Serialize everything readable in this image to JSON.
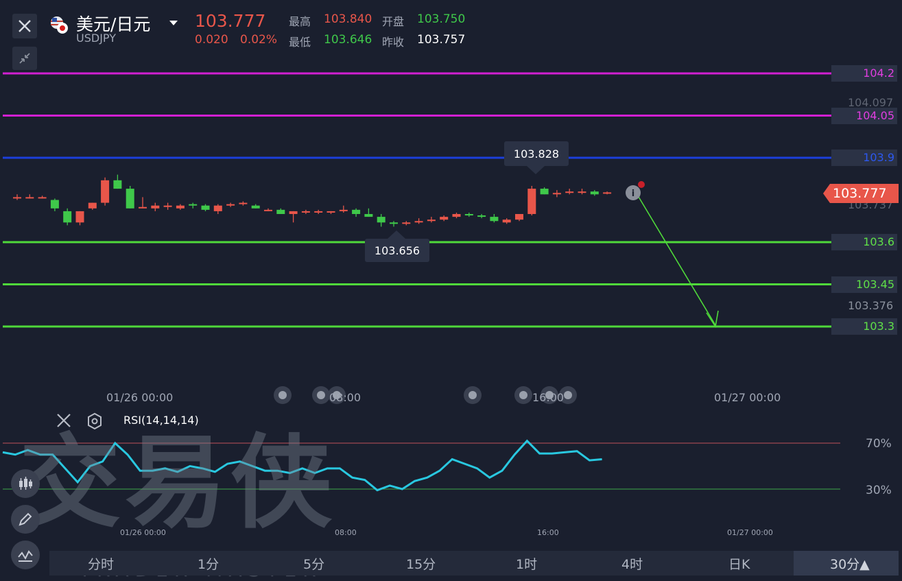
{
  "header": {
    "pair_name": "美元/日元",
    "symbol": "USDJPY",
    "price": "103.777",
    "change": "0.020",
    "change_pct": "0.02%",
    "high_label": "最高",
    "high_value": "103.840",
    "low_label": "最低",
    "low_value": "103.646",
    "open_label": "开盘",
    "open_value": "103.750",
    "prev_close_label": "昨收",
    "prev_close_value": "103.757"
  },
  "price_axis": {
    "current_price": "103.777",
    "faint_top": "104.097",
    "faint_mid": "103.737",
    "faint_bottom": "103.376"
  },
  "levels": [
    {
      "value": "104.2",
      "color": "#d21fd2"
    },
    {
      "value": "104.05",
      "color": "#d21fd2"
    },
    {
      "value": "103.9",
      "color": "#1c3fdc"
    },
    {
      "value": "103.6",
      "color": "#4fd93a"
    },
    {
      "value": "103.45",
      "color": "#4fd93a"
    },
    {
      "value": "103.3",
      "color": "#4fd93a"
    }
  ],
  "callouts": {
    "high_point": "103.828",
    "low_point": "103.656"
  },
  "time_axis": [
    "01/26 00:00",
    "08:00",
    "16:00",
    "01/27 00:00"
  ],
  "rsi": {
    "label": "RSI(14,14,14)",
    "upper": "70%",
    "lower": "30%"
  },
  "watermark": {
    "cn": "交易侠",
    "en": "TRADER MASTER"
  },
  "tabs": [
    "分时",
    "1分",
    "5分",
    "15分",
    "1时",
    "4时",
    "日K",
    "30分▲"
  ],
  "colors": {
    "up": "#e8564a",
    "down": "#3fc84a",
    "rsi_line": "#29c8e0",
    "background": "#1a1f2e"
  },
  "chart_data": {
    "type": "candlestick",
    "candles": [
      {
        "o": 103.76,
        "h": 103.77,
        "l": 103.75,
        "c": 103.76
      },
      {
        "o": 103.76,
        "h": 103.77,
        "l": 103.755,
        "c": 103.76
      },
      {
        "o": 103.76,
        "h": 103.765,
        "l": 103.755,
        "c": 103.76
      },
      {
        "o": 103.75,
        "h": 103.755,
        "l": 103.71,
        "c": 103.72
      },
      {
        "o": 103.71,
        "h": 103.72,
        "l": 103.66,
        "c": 103.67
      },
      {
        "o": 103.67,
        "h": 103.71,
        "l": 103.66,
        "c": 103.71
      },
      {
        "o": 103.72,
        "h": 103.74,
        "l": 103.715,
        "c": 103.74
      },
      {
        "o": 103.74,
        "h": 103.83,
        "l": 103.73,
        "c": 103.82
      },
      {
        "o": 103.82,
        "h": 103.84,
        "l": 103.79,
        "c": 103.79
      },
      {
        "o": 103.79,
        "h": 103.8,
        "l": 103.72,
        "c": 103.72
      },
      {
        "o": 103.72,
        "h": 103.76,
        "l": 103.72,
        "c": 103.725
      },
      {
        "o": 103.72,
        "h": 103.74,
        "l": 103.71,
        "c": 103.73
      },
      {
        "o": 103.725,
        "h": 103.74,
        "l": 103.715,
        "c": 103.73
      },
      {
        "o": 103.72,
        "h": 103.735,
        "l": 103.715,
        "c": 103.73
      },
      {
        "o": 103.735,
        "h": 103.74,
        "l": 103.72,
        "c": 103.73
      },
      {
        "o": 103.73,
        "h": 103.735,
        "l": 103.71,
        "c": 103.715
      },
      {
        "o": 103.71,
        "h": 103.735,
        "l": 103.7,
        "c": 103.73
      },
      {
        "o": 103.73,
        "h": 103.74,
        "l": 103.725,
        "c": 103.735
      },
      {
        "o": 103.735,
        "h": 103.745,
        "l": 103.73,
        "c": 103.74
      },
      {
        "o": 103.73,
        "h": 103.735,
        "l": 103.72,
        "c": 103.72
      },
      {
        "o": 103.715,
        "h": 103.72,
        "l": 103.71,
        "c": 103.715
      },
      {
        "o": 103.715,
        "h": 103.72,
        "l": 103.7,
        "c": 103.7
      },
      {
        "o": 103.7,
        "h": 103.71,
        "l": 103.67,
        "c": 103.71
      },
      {
        "o": 103.705,
        "h": 103.715,
        "l": 103.7,
        "c": 103.71
      },
      {
        "o": 103.705,
        "h": 103.715,
        "l": 103.7,
        "c": 103.71
      },
      {
        "o": 103.705,
        "h": 103.71,
        "l": 103.7,
        "c": 103.71
      },
      {
        "o": 103.71,
        "h": 103.73,
        "l": 103.705,
        "c": 103.715
      },
      {
        "o": 103.715,
        "h": 103.72,
        "l": 103.69,
        "c": 103.7
      },
      {
        "o": 103.7,
        "h": 103.72,
        "l": 103.69,
        "c": 103.69
      },
      {
        "o": 103.69,
        "h": 103.7,
        "l": 103.655,
        "c": 103.67
      },
      {
        "o": 103.67,
        "h": 103.675,
        "l": 103.655,
        "c": 103.665
      },
      {
        "o": 103.665,
        "h": 103.675,
        "l": 103.66,
        "c": 103.67
      },
      {
        "o": 103.67,
        "h": 103.685,
        "l": 103.665,
        "c": 103.675
      },
      {
        "o": 103.675,
        "h": 103.69,
        "l": 103.67,
        "c": 103.68
      },
      {
        "o": 103.68,
        "h": 103.695,
        "l": 103.675,
        "c": 103.69
      },
      {
        "o": 103.69,
        "h": 103.705,
        "l": 103.685,
        "c": 103.7
      },
      {
        "o": 103.7,
        "h": 103.705,
        "l": 103.69,
        "c": 103.695
      },
      {
        "o": 103.695,
        "h": 103.7,
        "l": 103.685,
        "c": 103.69
      },
      {
        "o": 103.69,
        "h": 103.7,
        "l": 103.67,
        "c": 103.675
      },
      {
        "o": 103.67,
        "h": 103.685,
        "l": 103.665,
        "c": 103.68
      },
      {
        "o": 103.68,
        "h": 103.7,
        "l": 103.675,
        "c": 103.7
      },
      {
        "o": 103.7,
        "h": 103.8,
        "l": 103.695,
        "c": 103.79
      },
      {
        "o": 103.79,
        "h": 103.795,
        "l": 103.77,
        "c": 103.77
      },
      {
        "o": 103.77,
        "h": 103.785,
        "l": 103.76,
        "c": 103.775
      },
      {
        "o": 103.775,
        "h": 103.79,
        "l": 103.77,
        "c": 103.78
      },
      {
        "o": 103.78,
        "h": 103.79,
        "l": 103.77,
        "c": 103.78
      },
      {
        "o": 103.78,
        "h": 103.785,
        "l": 103.765,
        "c": 103.77
      },
      {
        "o": 103.775,
        "h": 103.78,
        "l": 103.77,
        "c": 103.777
      }
    ],
    "rsi_values": [
      62,
      60,
      64,
      60,
      60,
      48,
      36,
      50,
      54,
      70,
      60,
      46,
      46,
      48,
      45,
      50,
      48,
      45,
      52,
      54,
      50,
      46,
      46,
      44,
      48,
      44,
      48,
      48,
      40,
      38,
      29,
      33,
      30,
      37,
      40,
      46,
      56,
      52,
      48,
      40,
      46,
      60,
      72,
      61,
      61,
      62,
      63,
      55,
      56
    ]
  }
}
